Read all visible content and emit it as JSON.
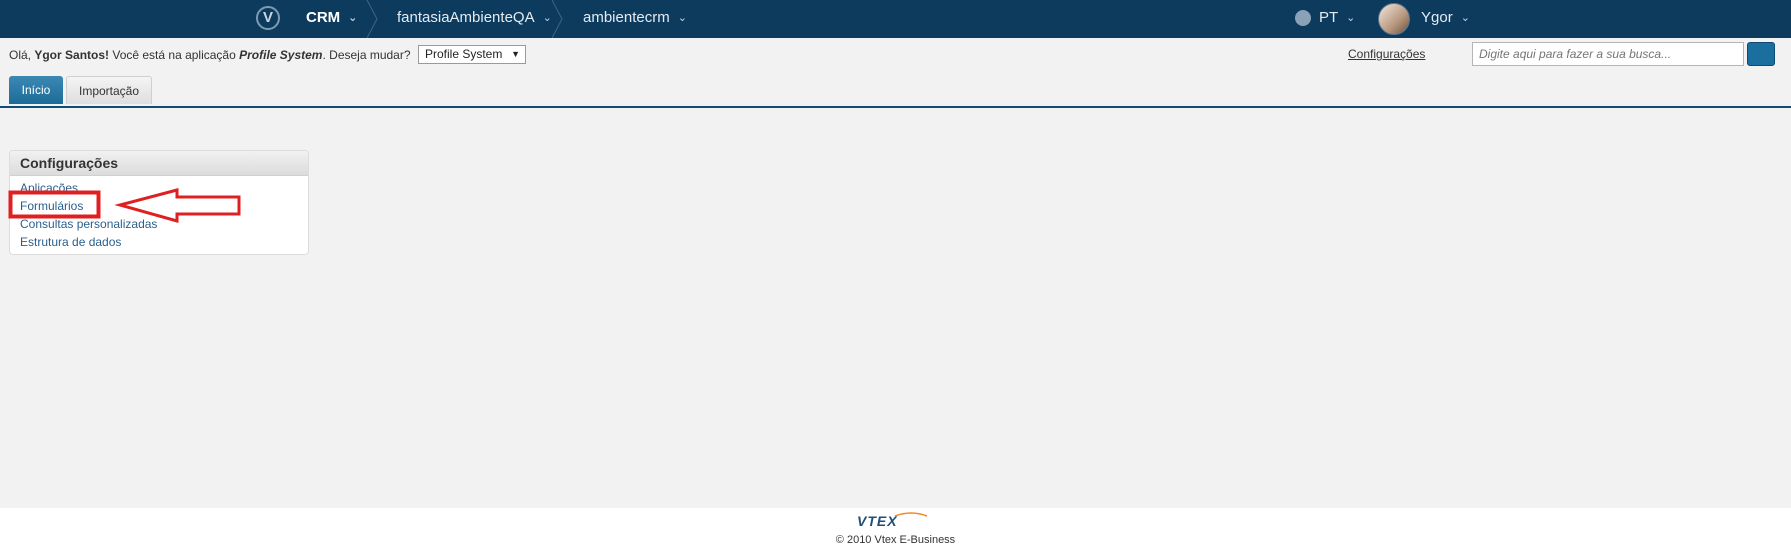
{
  "topbar": {
    "breadcrumbs": [
      {
        "label": "CRM"
      },
      {
        "label": "fantasiaAmbienteQA"
      },
      {
        "label": "ambientecrm"
      }
    ],
    "language": "PT",
    "user": "Ygor"
  },
  "subbar": {
    "greeting_prefix": "Olá, ",
    "user_full_name": "Ygor Santos!",
    "greeting_mid": " Você está na aplicação ",
    "app_name": "Profile System",
    "greeting_suffix": ". Deseja mudar?",
    "app_select_value": "Profile System",
    "settings_link": "Configurações",
    "search_placeholder": "Digite aqui para fazer a sua busca..."
  },
  "tabs": [
    {
      "label": "Início",
      "active": true
    },
    {
      "label": "Importação",
      "active": false
    }
  ],
  "panel": {
    "title": "Configurações",
    "links": [
      "Aplicações",
      "Formulários",
      "Consultas personalizadas",
      "Estrutura de dados"
    ]
  },
  "annotation": {
    "color": "#e02020",
    "highlighted_item": "Formulários"
  },
  "footer": {
    "brand": "VTEX",
    "copyright": "© 2010 Vtex E-Business"
  },
  "colors": {
    "topbar": "#0d3b5e",
    "accent": "#1c6c98",
    "link": "#2a5f8c"
  }
}
